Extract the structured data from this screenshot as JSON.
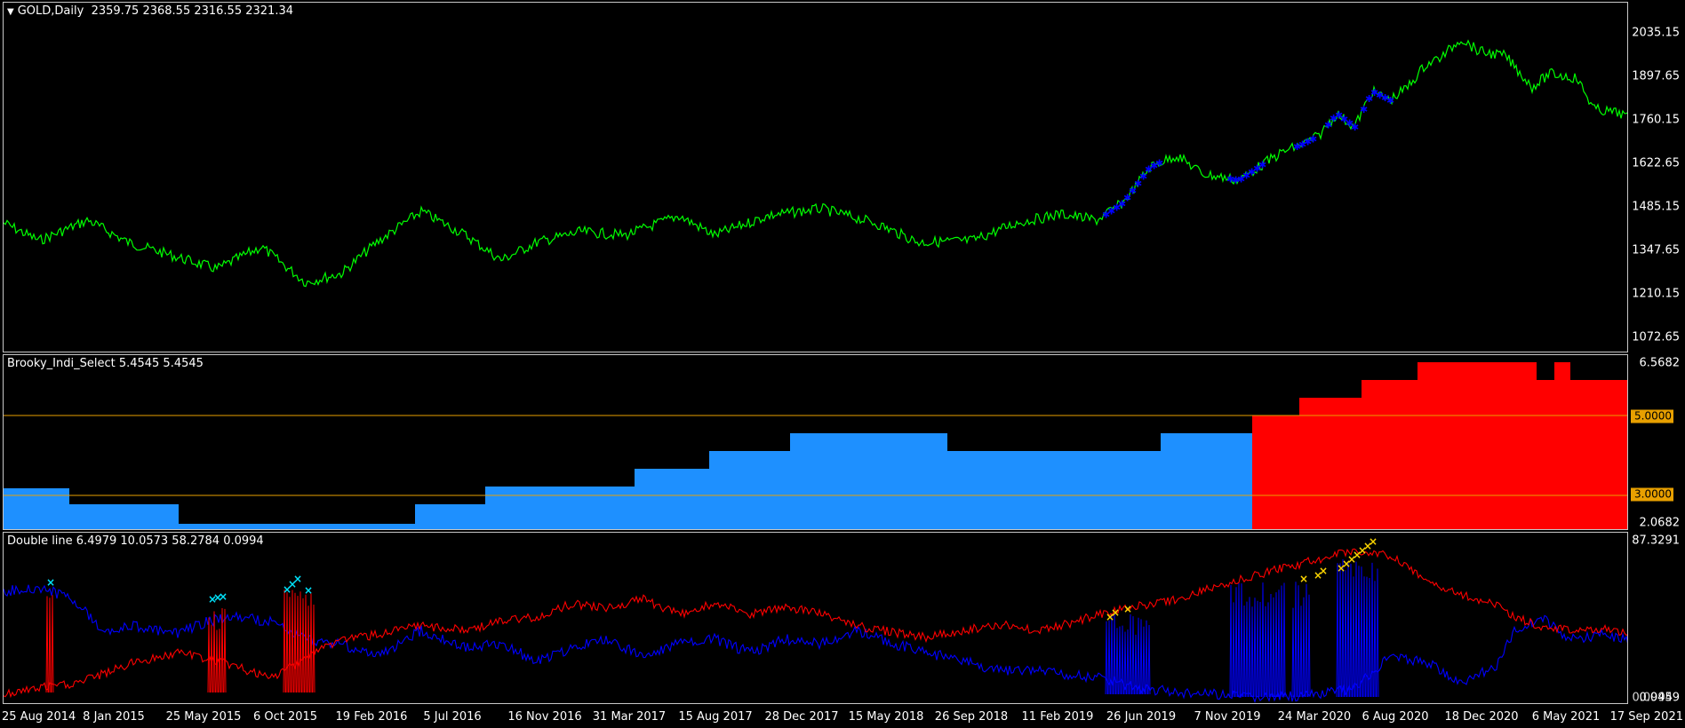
{
  "main_pane": {
    "symbol_label": "GOLD,Daily",
    "ohlc": "2359.75 2368.55 2316.55 2321.34",
    "price_axis": [
      "2035.15",
      "1897.65",
      "1760.15",
      "1622.65",
      "1485.15",
      "1347.65",
      "1210.15",
      "1072.65"
    ],
    "colors": {
      "price_line": "#00ff00",
      "marker": "#0000ff",
      "background": "#000000"
    }
  },
  "indicator_pane": {
    "title": "Brooky_Indi_Select 5.4545 5.4545",
    "axis_top": "6.5682",
    "axis_bottom": "2.0682",
    "levels": [
      "5.0000",
      "3.0000"
    ],
    "colors": {
      "low": "#1e90ff",
      "high": "#ff0000",
      "level_line": "#e8a000"
    }
  },
  "double_line_pane": {
    "title": "Double line 6.4979 10.0573 58.2784 0.0994",
    "axis_top": "87.3291",
    "axis_bottom": "0.0459",
    "axis_bottom_overlap": "0.0994",
    "colors": {
      "line_a": "#ff0000",
      "line_b": "#0000ff",
      "cross_a": "#00e5ff",
      "cross_b": "#ffd700"
    }
  },
  "time_axis": [
    "25 Aug 2014",
    "8 Jan 2015",
    "25 May 2015",
    "6 Oct 2015",
    "19 Feb 2016",
    "5 Jul 2016",
    "16 Nov 2016",
    "31 Mar 2017",
    "15 Aug 2017",
    "28 Dec 2017",
    "15 May 2018",
    "26 Sep 2018",
    "11 Feb 2019",
    "26 Jun 2019",
    "7 Nov 2019",
    "24 Mar 2020",
    "6 Aug 2020",
    "18 Dec 2020",
    "6 May 2021",
    "17 Sep 2021"
  ]
}
